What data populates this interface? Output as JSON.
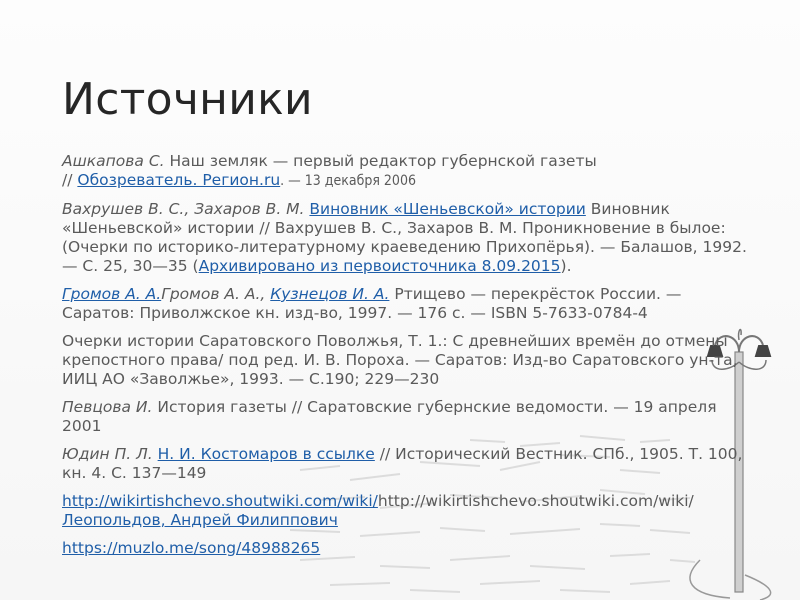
{
  "slide": {
    "title": "Источники",
    "entries": [
      {
        "a1": "Ашкапова С.",
        "b1": " Наш земляк — первый редактор губернской газеты",
        "b2": "// ",
        "link": "Обозреватель. Регион.ru",
        "b3": ". — 13 декабря 2006"
      },
      {
        "a1": "Вахрушев В. С., Захаров В. М.",
        "sp": " ",
        "link": "Виновник «Шеньевской» истории",
        "b1": " Виновник «Шеньевской» истории // Вахрушев В. С., Захаров В. М. Проникновение в былое: (Очерки по историко-литературному краеведению Прихопёрья). — Балашов, 1992. — С. 25, 30—35 (",
        "link2": "Архивировано из первоисточника 8.09.2015",
        "b2": ")."
      },
      {
        "link": "Громов А. А.",
        "a1": "Громов А. А.,",
        "sp": " ",
        "link2": "Кузнецов И. А.",
        "b1": " Ртищево — перекрёсток России. — Саратов: Приволжское кн. изд-во, 1997. — 176 с. — ISBN 5-7633-0784-4"
      },
      {
        "b1": "Очерки истории Саратовского Поволжья, Т. 1.: С древнейших времён до отмены крепостного права/ под ред. И. В. Пороха. — Саратов: Изд-во Саратовского ун-та, ИИЦ АО «Заволжье», 1993. — С.190; 229—230"
      },
      {
        "a1": "Певцова И.",
        "b1": " История газеты // Саратовские губернские ведомости. — 19 апреля 2001"
      },
      {
        "a1": "Юдин П. Л.",
        "sp": " ",
        "link": "Н. И. Костомаров в ссылке",
        "b1": " // Исторический Вестник. СПб., 1905. Т. 100, кн. 4. С. 137—149"
      },
      {
        "link": "http://wikirtishchevo.shoutwiki.com/wiki/",
        "b1": "http://wikirtishchevo.shoutwiki.com/wiki/",
        "link2": "Леопольдов, Андрей Филиппович"
      },
      {
        "link": "https://muzlo.me/song/48988265"
      }
    ]
  },
  "colors": {
    "text": "#5a5a5a",
    "title": "#262626",
    "link": "#1f5ea8",
    "background": "#fafafa"
  }
}
